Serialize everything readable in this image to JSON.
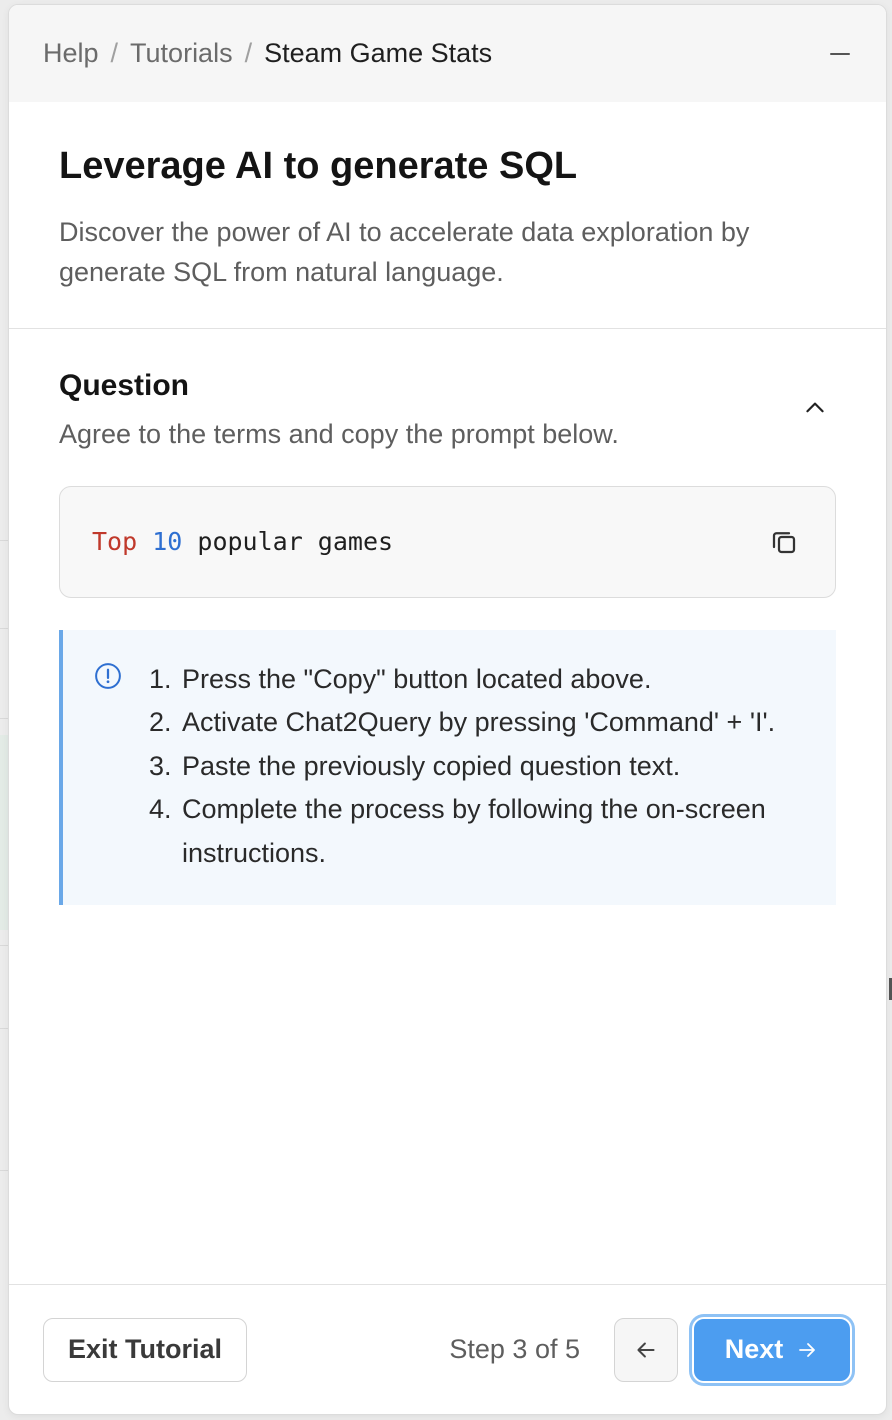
{
  "breadcrumb": {
    "items": [
      "Help",
      "Tutorials",
      "Steam Game Stats"
    ],
    "separator": "/"
  },
  "intro": {
    "title": "Leverage AI to generate SQL",
    "description": "Discover the power of AI to accelerate data exploration by generate SQL from natural language."
  },
  "question": {
    "heading": "Question",
    "subtitle": "Agree to the terms and copy the prompt below.",
    "prompt": {
      "keyword": "Top",
      "number": "10",
      "rest": "popular games"
    }
  },
  "instructions": {
    "steps": [
      {
        "n": "1.",
        "text": "Press the \"Copy\" button located above."
      },
      {
        "n": "2.",
        "text": "Activate Chat2Query by pressing 'Command' + 'I'."
      },
      {
        "n": "3.",
        "text": "Paste the previously copied question text."
      },
      {
        "n": "4.",
        "text": "Complete the process by following the on-screen instructions."
      }
    ]
  },
  "footer": {
    "exit_label": "Exit Tutorial",
    "step_text": "Step 3 of 5",
    "next_label": "Next"
  },
  "icons": {
    "minimize": "minus-icon",
    "collapse": "chevron-up-icon",
    "copy": "copy-icon",
    "info": "info-circle-icon",
    "prev": "arrow-left-icon",
    "next": "arrow-right-icon"
  },
  "colors": {
    "accent": "#4c9df0",
    "info_bg": "#f3f8fd",
    "info_border": "#6aa8e8",
    "code_keyword": "#c0392b",
    "code_number": "#2e6fd1"
  }
}
